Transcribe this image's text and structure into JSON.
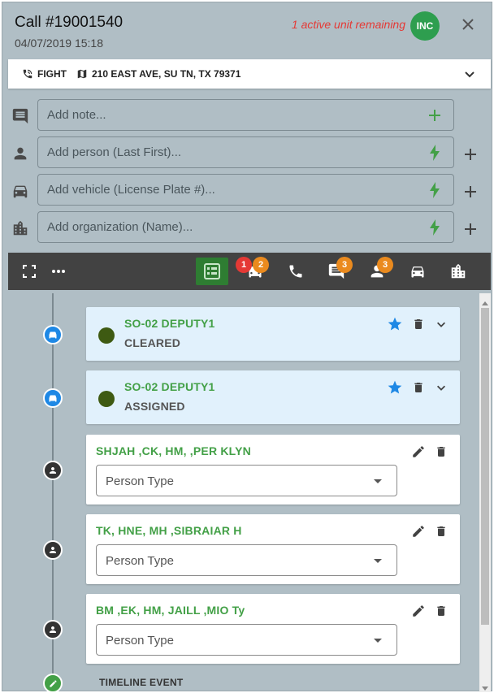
{
  "header": {
    "title": "Call #19001540",
    "datetime": "04/07/2019 15:18",
    "remaining": "1 active unit remaining",
    "badge": "INC"
  },
  "address": {
    "call_type": "FIGHT",
    "location": "210 EAST AVE, SU TN, TX 79371"
  },
  "inputs": {
    "note_placeholder": "Add note...",
    "person_placeholder": "Add person (Last First)...",
    "vehicle_placeholder": "Add vehicle (License Plate #)...",
    "organization_placeholder": "Add organization (Name)..."
  },
  "toolbar": {
    "units_red_count": "1",
    "units_orange_count": "2",
    "messages_count": "3",
    "persons_count": "3"
  },
  "timeline": {
    "units": [
      {
        "name": "SO-02 DEPUTY1",
        "status": "CLEARED"
      },
      {
        "name": "SO-02 DEPUTY1",
        "status": "ASSIGNED"
      }
    ],
    "persons": [
      {
        "name": "SHJAH ,CK, HM, ,PER KLYN",
        "type_placeholder": "Person Type"
      },
      {
        "name": "TK, HNE, MH ,SIBRAIAR H",
        "type_placeholder": "Person Type"
      },
      {
        "name": "BM ,EK, HM, JAILL ,MIO Ty",
        "type_placeholder": "Person Type"
      }
    ],
    "event_label": "TIMELINE EVENT"
  },
  "colors": {
    "panel": "#b0bec5",
    "accent_green": "#43a047",
    "alert_red": "#e53935",
    "badge_orange": "#ea8a1e",
    "unit_card": "#e1f1fc",
    "star_blue": "#1e88e5"
  }
}
